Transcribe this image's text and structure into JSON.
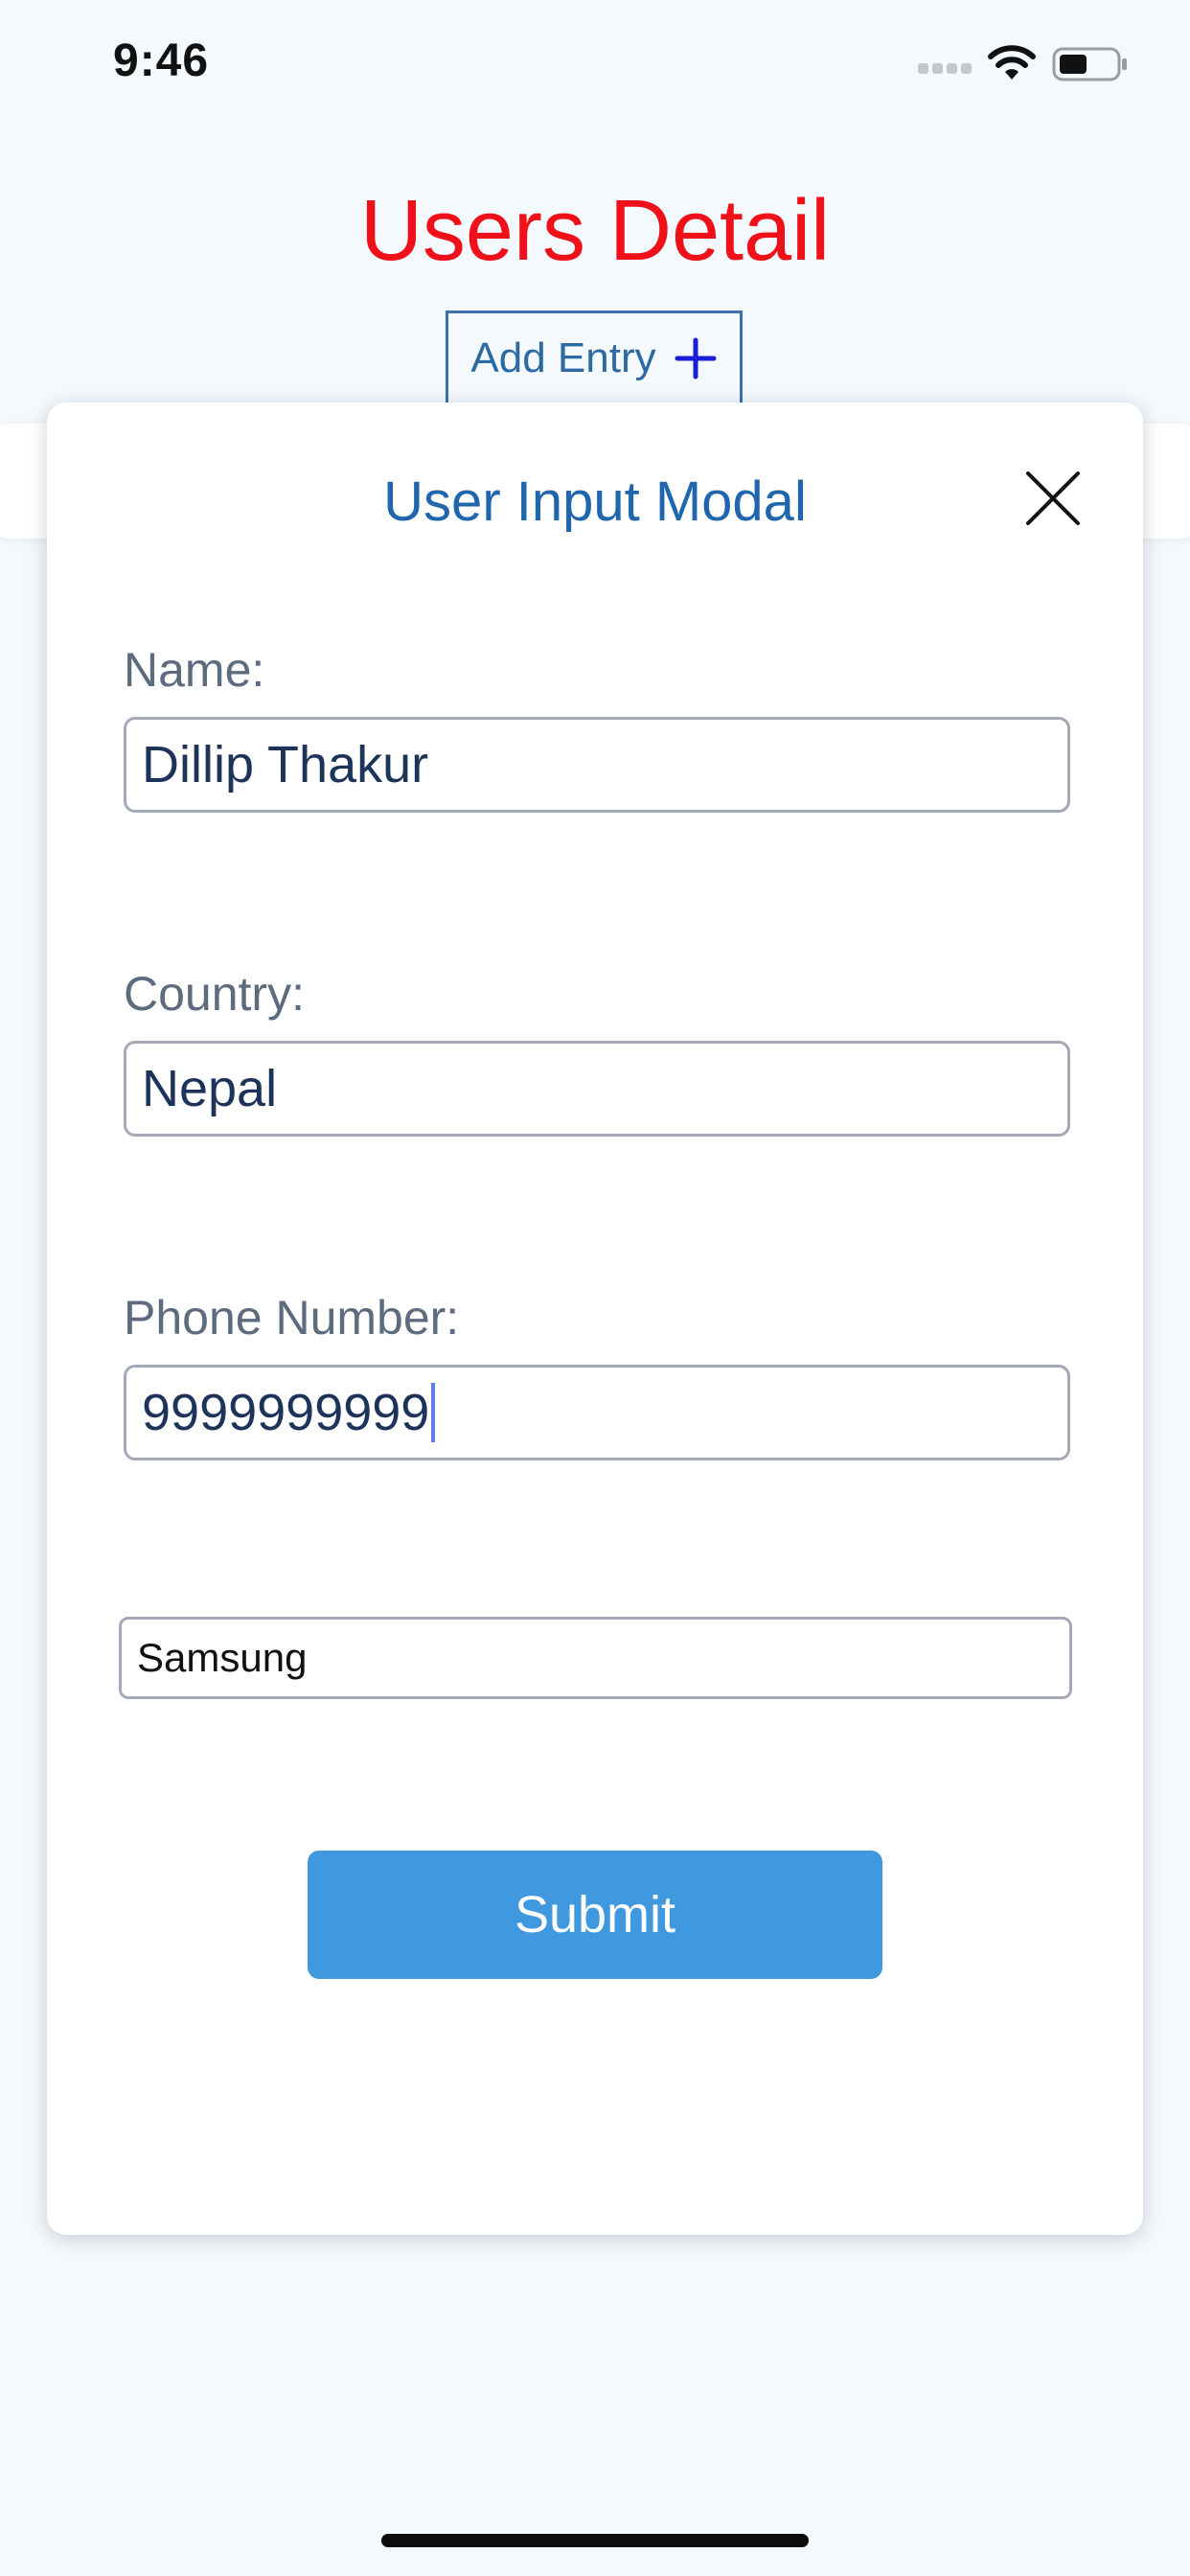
{
  "status_bar": {
    "time": "9:46",
    "icons": [
      "signal-dots-icon",
      "wifi-icon",
      "battery-icon"
    ]
  },
  "page": {
    "title": "Users Detail",
    "title_color": "#f0101a",
    "add_entry_label": "Add Entry"
  },
  "modal": {
    "title": "User Input Modal",
    "fields": [
      {
        "label": "Name:",
        "value": "Dillip Thakur"
      },
      {
        "label": "Country:",
        "value": "Nepal"
      },
      {
        "label": "Phone Number:",
        "value": "9999999999"
      }
    ],
    "device_value": "Samsung",
    "submit_label": "Submit",
    "submit_color": "#4098df"
  }
}
